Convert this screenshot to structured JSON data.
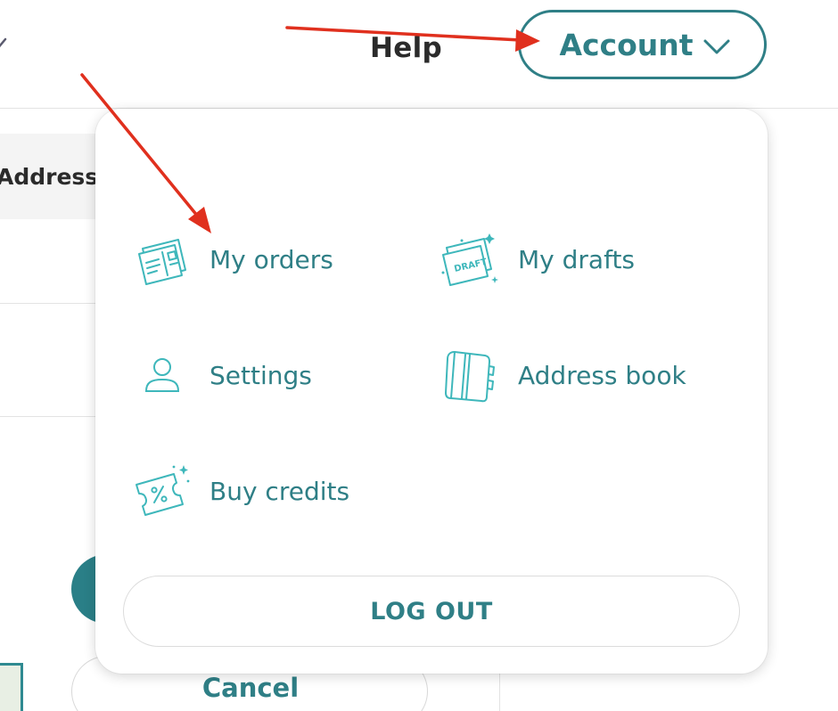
{
  "header": {
    "help_label": "Help",
    "account_label": "Account"
  },
  "background": {
    "address_tab_label": "Address",
    "cancel_label": "Cancel"
  },
  "account_menu": {
    "items": [
      {
        "label": "My orders",
        "icon": "orders-icon"
      },
      {
        "label": "My drafts",
        "icon": "drafts-icon",
        "icon_text": "DRAFT"
      },
      {
        "label": "Settings",
        "icon": "user-icon"
      },
      {
        "label": "Address book",
        "icon": "address-book-icon"
      },
      {
        "label": "Buy credits",
        "icon": "ticket-percent-icon"
      }
    ],
    "logout_label": "LOG OUT"
  },
  "colors": {
    "accent": "#2f7f86",
    "icon": "#3eb7bb",
    "annotation_arrow": "#e0301e"
  }
}
